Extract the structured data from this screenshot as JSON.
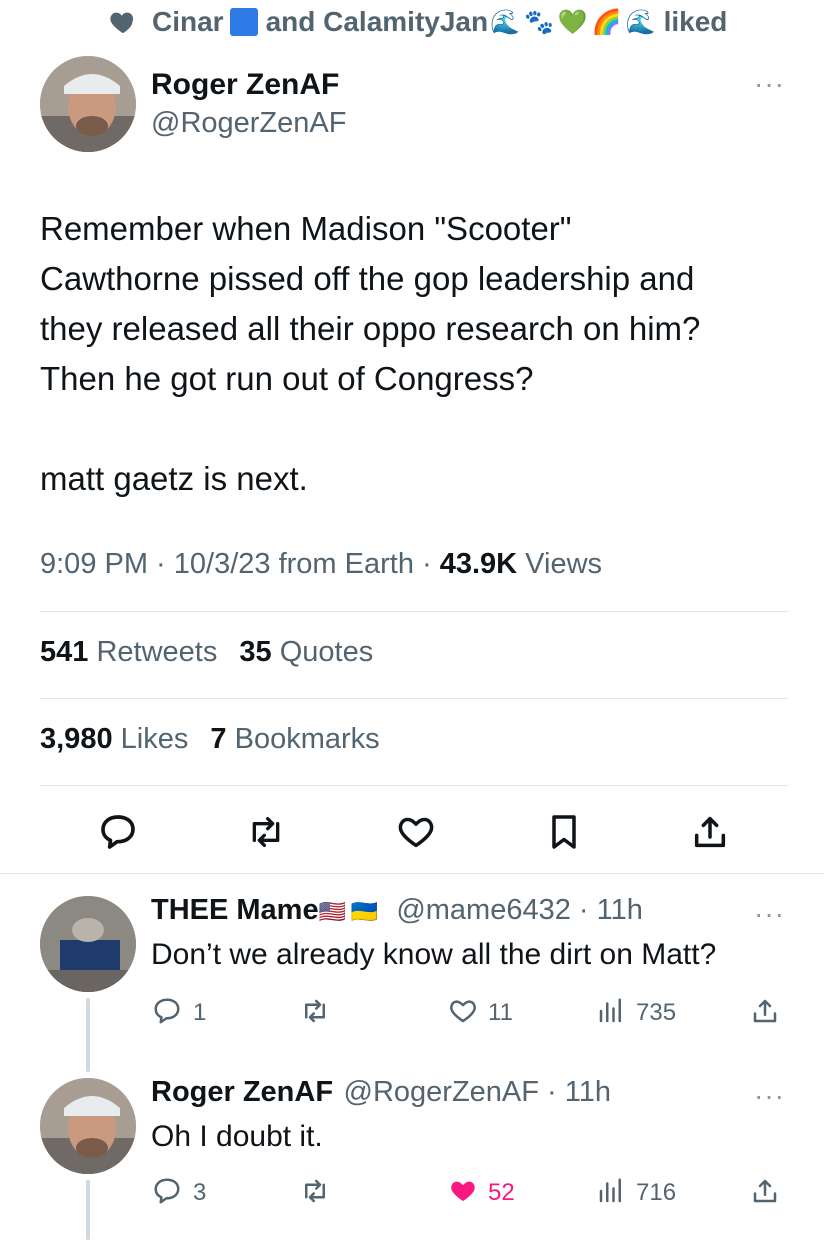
{
  "social_context": {
    "name1": "Cinar",
    "connector": "and CalamityJan",
    "suffix": "liked",
    "emojis": [
      "🌊",
      "🐾",
      "💚",
      "🌈",
      "🌊"
    ]
  },
  "tweet": {
    "display_name": "Roger ZenAF",
    "handle": "@RogerZenAF",
    "body_lines": [
      "Remember when Madison \"Scooter\"",
      "Cawthorne pissed off the gop leadership and",
      "they released all their oppo research on him?",
      "Then he got run out of Congress?",
      "matt gaetz is next."
    ],
    "time": "9:09 PM · 10/3/23 from Earth · ",
    "views_count": "43.9K",
    "views_label": " Views",
    "retweets_count": "541",
    "retweets_label": "Retweets",
    "quotes_count": "35",
    "quotes_label": "Quotes",
    "likes_count": "3,980",
    "likes_label": "Likes",
    "bookmarks_count": "7",
    "bookmarks_label": "Bookmarks"
  },
  "replies": [
    {
      "display_name": "THEE Mame",
      "flags": [
        "🇺🇸",
        "🇺🇦"
      ],
      "handle_time": "@mame6432 · 11h",
      "text": "Don’t we already know all the dirt on Matt?",
      "replies": "1",
      "likes": "11",
      "views": "735",
      "liked": false
    },
    {
      "display_name": "Roger ZenAF",
      "handle_time": "@RogerZenAF · 11h",
      "text": "Oh I doubt it.",
      "replies": "3",
      "likes": "52",
      "views": "716",
      "liked": true
    }
  ],
  "more_label": "···",
  "colors": {
    "text": "#0f1419",
    "secondary": "#536471",
    "like_pink": "#f91880",
    "divider": "#e1e6ea"
  },
  "icons": [
    "heart-icon",
    "reply-icon",
    "retweet-icon",
    "like-icon",
    "bookmark-icon",
    "share-icon",
    "views-icon",
    "more-icon"
  ]
}
